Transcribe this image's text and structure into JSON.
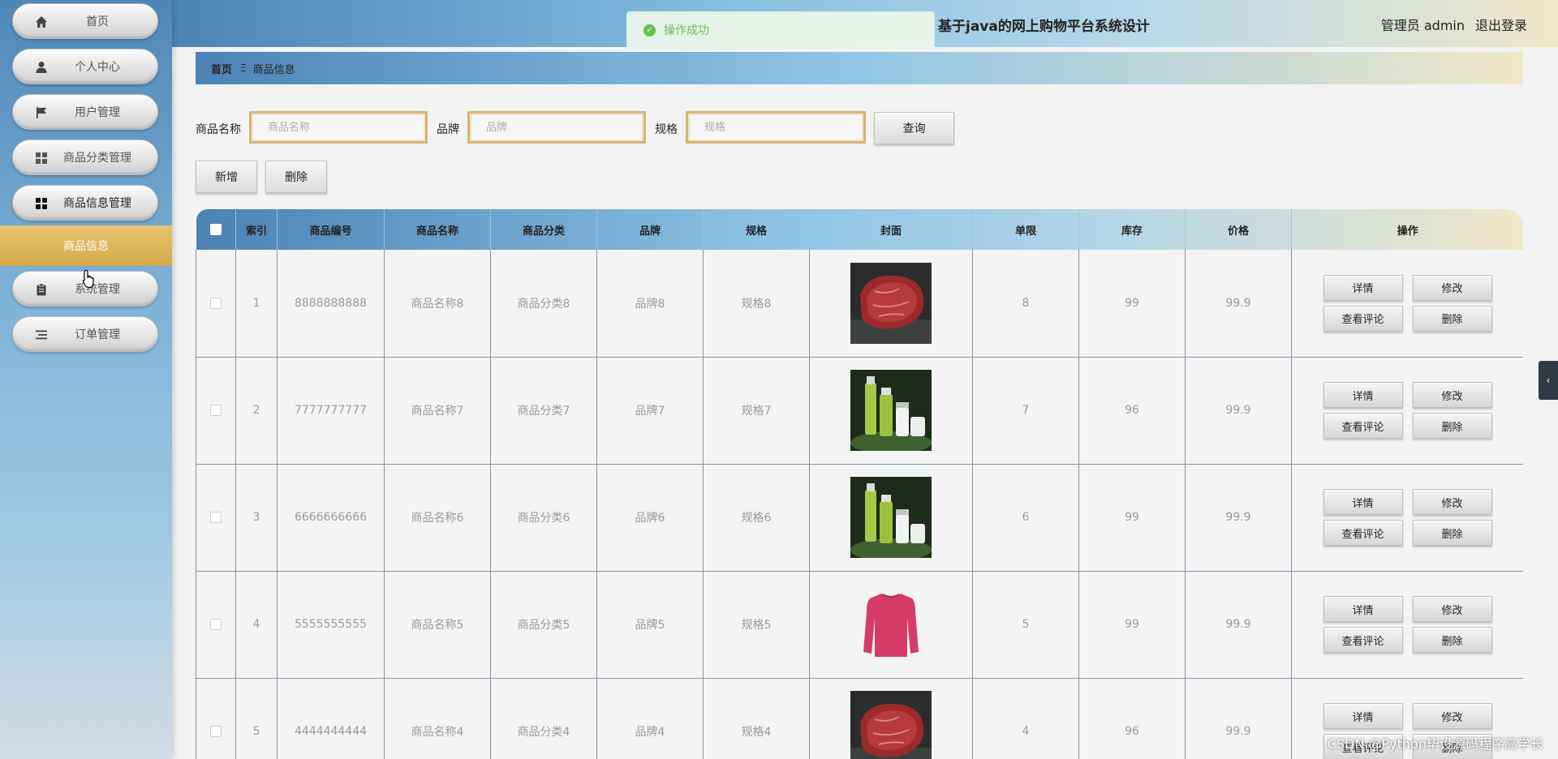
{
  "header": {
    "site_title": "基于java的网上购物平台系统设计",
    "admin_label": "管理员 admin",
    "logout_label": "退出登录"
  },
  "toast": {
    "message": "操作成功",
    "color": "#67c23a"
  },
  "sidebar": {
    "items": [
      {
        "label": "首页",
        "icon": "home-icon"
      },
      {
        "label": "个人中心",
        "icon": "user-icon"
      },
      {
        "label": "用户管理",
        "icon": "flag-icon"
      },
      {
        "label": "商品分类管理",
        "icon": "grid-icon"
      },
      {
        "label": "商品信息管理",
        "icon": "grid-icon"
      },
      {
        "label": "系统管理",
        "icon": "clipboard-icon"
      },
      {
        "label": "订单管理",
        "icon": "list-icon"
      }
    ],
    "active_submenu": "商品信息",
    "accent": "#d9ae55"
  },
  "breadcrumb": {
    "home": "首页",
    "separator": "Ξ",
    "current": "商品信息"
  },
  "search": {
    "fields": [
      {
        "label": "商品名称",
        "placeholder": "商品名称",
        "value": ""
      },
      {
        "label": "品牌",
        "placeholder": "品牌",
        "value": ""
      },
      {
        "label": "规格",
        "placeholder": "规格",
        "value": ""
      }
    ],
    "query_label": "查询"
  },
  "actions": {
    "add_label": "新增",
    "delete_label": "删除"
  },
  "table": {
    "columns": [
      "索引",
      "商品编号",
      "商品名称",
      "商品分类",
      "品牌",
      "规格",
      "封面",
      "单限",
      "库存",
      "价格",
      "操作"
    ],
    "rows": [
      {
        "index": "1",
        "code": "8888888888",
        "name": "商品名称8",
        "category": "商品分类8",
        "brand": "品牌8",
        "spec": "规格8",
        "cover": "beef",
        "limit": "8",
        "stock": "99",
        "price": "99.9"
      },
      {
        "index": "2",
        "code": "7777777777",
        "name": "商品名称7",
        "category": "商品分类7",
        "brand": "品牌7",
        "spec": "规格7",
        "cover": "cosmetics",
        "limit": "7",
        "stock": "96",
        "price": "99.9"
      },
      {
        "index": "3",
        "code": "6666666666",
        "name": "商品名称6",
        "category": "商品分类6",
        "brand": "品牌6",
        "spec": "规格6",
        "cover": "cosmetics",
        "limit": "6",
        "stock": "99",
        "price": "99.9"
      },
      {
        "index": "4",
        "code": "5555555555",
        "name": "商品名称5",
        "category": "商品分类5",
        "brand": "品牌5",
        "spec": "规格5",
        "cover": "sweater",
        "limit": "5",
        "stock": "99",
        "price": "99.9"
      },
      {
        "index": "5",
        "code": "4444444444",
        "name": "商品名称4",
        "category": "商品分类4",
        "brand": "品牌4",
        "spec": "规格4",
        "cover": "beef",
        "limit": "4",
        "stock": "96",
        "price": "99.9"
      }
    ],
    "ops": {
      "detail": "详情",
      "edit": "修改",
      "review": "查看评论",
      "delete": "删除"
    }
  },
  "watermark": "CSDN @Python毕设源码程序高学长"
}
